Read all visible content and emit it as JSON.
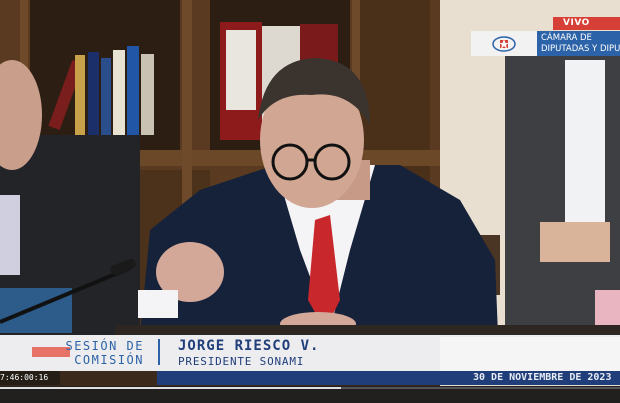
{
  "broadcast": {
    "live_label": "VIVO",
    "chamber_name_line1": "CÁMARA DE",
    "chamber_name_line2": "DIPUTADAS Y DIPUTADOS"
  },
  "lower_third": {
    "session_line1": "SESIÓN DE",
    "session_line2": "COMISIÓN",
    "speaker_name": "JORGE RIESCO V.",
    "speaker_title": "PRESIDENTE SONAMI",
    "date": "30 DE NOVIEMBRE DE 2023"
  },
  "player": {
    "timecode": "7:46:00:16",
    "progress": 0.55
  },
  "colors": {
    "accent_blue": "#2c63a8",
    "navy": "#1f3e7a",
    "live_red": "#d64036",
    "tie_red": "#c8282c"
  }
}
